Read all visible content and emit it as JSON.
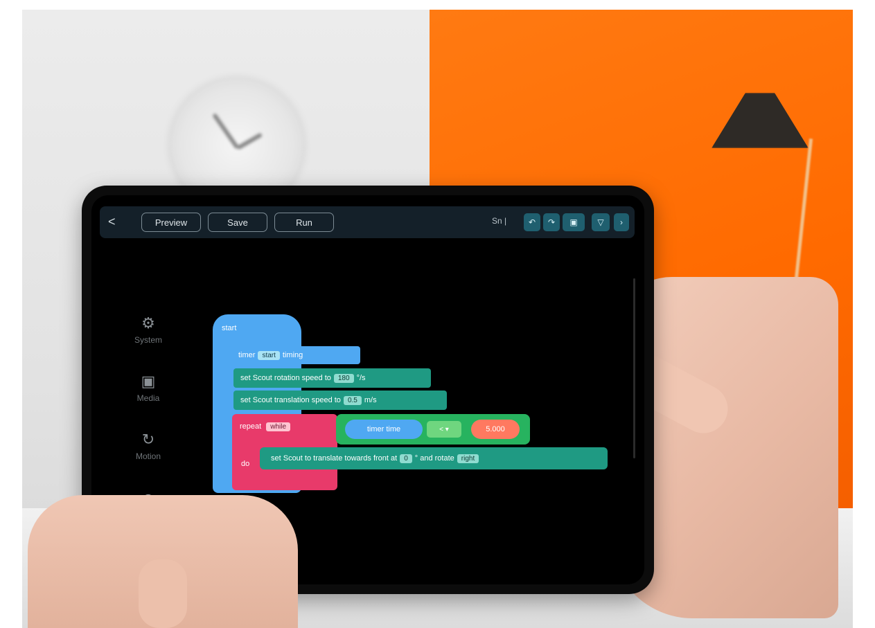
{
  "toolbar": {
    "back_label": "<",
    "preview_label": "Preview",
    "save_label": "Save",
    "run_label": "Run",
    "right_label": "Sn |"
  },
  "sidebar": {
    "items": [
      {
        "label": "System",
        "icon": "gear-icon"
      },
      {
        "label": "Media",
        "icon": "media-icon"
      },
      {
        "label": "Motion",
        "icon": "motion-icon"
      },
      {
        "label": "",
        "icon": "add-icon"
      }
    ]
  },
  "blocks": {
    "start_label": "start",
    "timer": {
      "prefix": "timer",
      "field": "start",
      "suffix": "timing"
    },
    "rotation": {
      "text": "set Scout rotation speed to",
      "value": "180",
      "unit": "°/s"
    },
    "translation": {
      "text": "set Scout translation speed to",
      "value": "0.5",
      "unit": "m/s"
    },
    "repeat": {
      "label": "repeat",
      "field": "while"
    },
    "condition": {
      "left": "timer time",
      "op": "< ▾",
      "right": "5.000"
    },
    "do_label": "do",
    "move": {
      "text": "set Scout to translate towards front at",
      "value": "0",
      "mid": "° and rotate",
      "field": "right"
    }
  },
  "colors": {
    "wall_orange": "#ff6a00",
    "block_blue": "#4fa8f2",
    "block_green": "#1f9a83",
    "block_pink": "#e83a6a",
    "block_condition": "#27b35f",
    "block_orange": "#ff7960"
  }
}
